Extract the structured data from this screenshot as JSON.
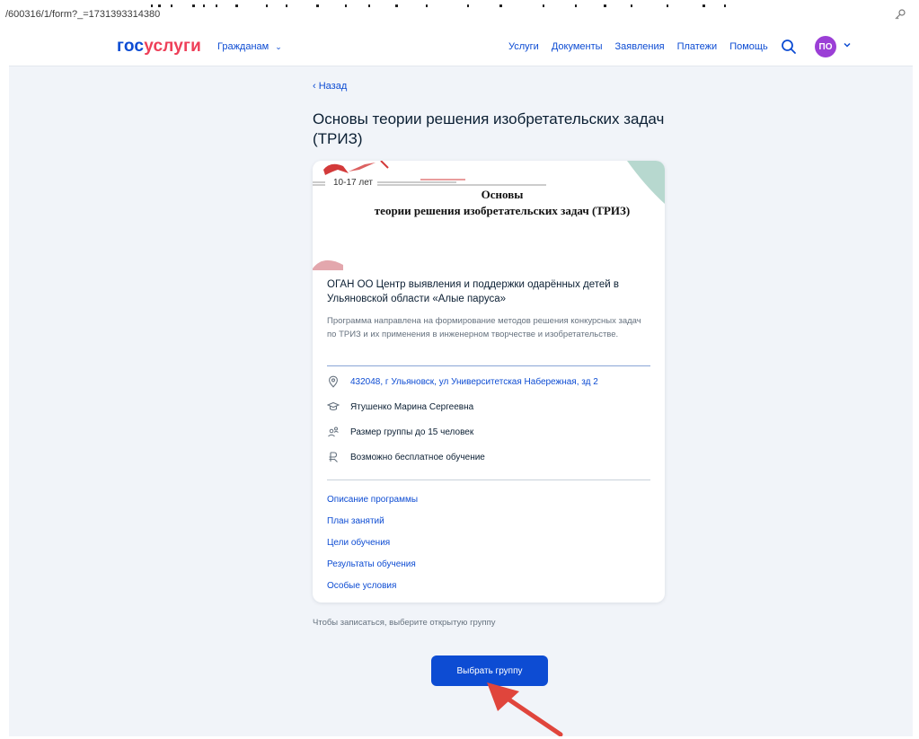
{
  "browser": {
    "url": "/600316/1/form?_=1731393314380",
    "key_icon": "key-icon"
  },
  "header": {
    "logo_part1": "гос",
    "logo_part2": "услуги",
    "citizens_label": "Гражданам",
    "nav": [
      "Услуги",
      "Документы",
      "Заявления",
      "Платежи",
      "Помощь"
    ],
    "avatar_initials": "ПО",
    "accent": "#0d4cd3",
    "brand_red": "#ee3f58",
    "avatar_color": "#9b3fd6"
  },
  "page": {
    "back_label": "Назад",
    "title": "Основы теории решения изобретательских задач (ТРИЗ)"
  },
  "card": {
    "banner": {
      "age": "10-17 лет",
      "title_line1": "Основы",
      "title_line2": "теории решения изобретательских задач (ТРИЗ)"
    },
    "organization": "ОГАН ОО Центр выявления и поддержки одарённых детей в Ульяновской области «Алые паруса»",
    "description": "Программа направлена на формирование методов решения конкурсных задач по ТРИЗ и их применения в инженерном творчестве и изобретательстве.",
    "address": "432048, г Ульяновск, ул Университетская Набережная, зд 2",
    "teacher": "Ятушенко Марина Сергеевна",
    "group_size": "Размер группы до 15 человек",
    "free": "Возможно бесплатное обучение",
    "links": [
      "Описание программы",
      "План занятий",
      "Цели обучения",
      "Результаты обучения",
      "Особые условия"
    ]
  },
  "footer": {
    "hint": "Чтобы записаться, выберите открытую группу",
    "select_group_label": "Выбрать группу"
  }
}
